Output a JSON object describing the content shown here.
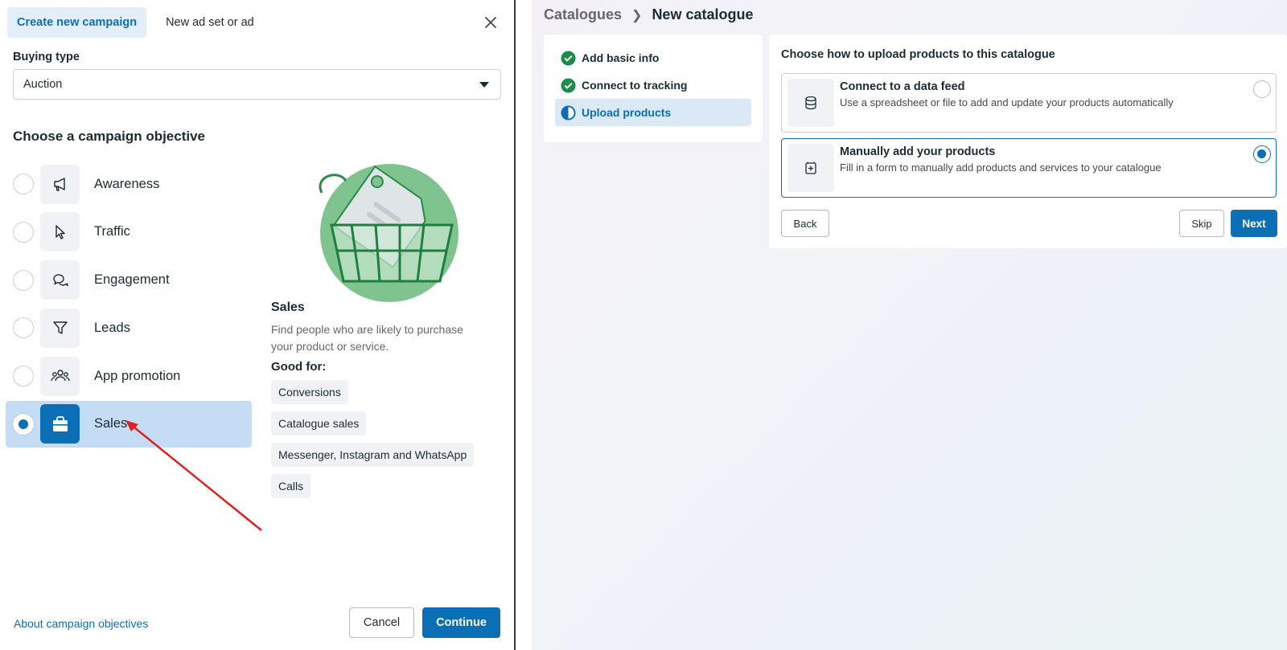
{
  "campaign_dialog": {
    "tabs": [
      {
        "label": "Create new campaign",
        "active": true
      },
      {
        "label": "New ad set or ad",
        "active": false
      }
    ],
    "close_icon": "close-icon",
    "buying_type": {
      "label": "Buying type",
      "value": "Auction"
    },
    "objective_heading": "Choose a campaign objective",
    "objectives": [
      {
        "label": "Awareness",
        "icon": "megaphone-icon",
        "selected": false
      },
      {
        "label": "Traffic",
        "icon": "cursor-icon",
        "selected": false
      },
      {
        "label": "Engagement",
        "icon": "chat-bubbles-icon",
        "selected": false
      },
      {
        "label": "Leads",
        "icon": "filter-icon",
        "selected": false
      },
      {
        "label": "App promotion",
        "icon": "people-icon",
        "selected": false
      },
      {
        "label": "Sales",
        "icon": "shopping-bag-icon",
        "selected": true
      }
    ],
    "detail": {
      "title": "Sales",
      "description": "Find people who are likely to purchase your product or service.",
      "good_for_label": "Good for:",
      "good_for": [
        "Conversions",
        "Catalogue sales",
        "Messenger, Instagram and WhatsApp",
        "Calls"
      ]
    },
    "footer": {
      "about_link": "About campaign objectives",
      "cancel": "Cancel",
      "continue": "Continue"
    },
    "colors": {
      "accent": "#0a6fb5",
      "selected_bg": "#c4ddf4",
      "annotation_arrow": "#e02020"
    }
  },
  "catalogue_page": {
    "breadcrumb": {
      "parent": "Catalogues",
      "current": "New catalogue"
    },
    "steps": [
      {
        "label": "Add basic info",
        "status": "complete"
      },
      {
        "label": "Connect to tracking",
        "status": "complete"
      },
      {
        "label": "Upload products",
        "status": "current"
      }
    ],
    "upload": {
      "title": "Choose how to upload products to this catalogue",
      "options": [
        {
          "title": "Connect to a data feed",
          "description": "Use a spreadsheet or file to add and update your products automatically",
          "icon": "database-icon",
          "selected": false
        },
        {
          "title": "Manually add your products",
          "description": "Fill in a form to manually add products and services to your catalogue",
          "icon": "add-product-icon",
          "selected": true
        }
      ],
      "back": "Back",
      "skip": "Skip",
      "next": "Next"
    },
    "colors": {
      "complete_green": "#1e8a4c",
      "accent": "#0a6fb5"
    }
  }
}
